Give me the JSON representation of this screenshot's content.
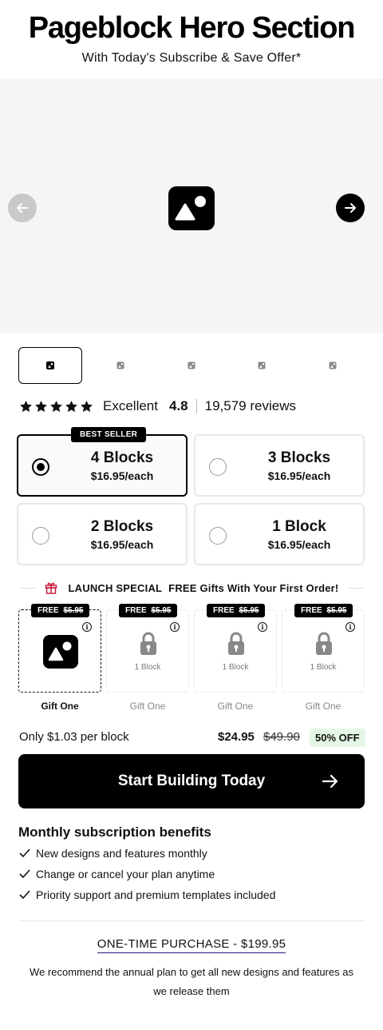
{
  "header": {
    "title": "Pageblock Hero Section",
    "subtitle": "With Today's Subscribe & Save Offer*"
  },
  "gallery": {
    "icon": "image-placeholder-icon",
    "prev_icon": "arrow-left-icon",
    "next_icon": "arrow-right-icon",
    "thumbnail_count": 5,
    "active_thumbnail": 1
  },
  "rating": {
    "stars": 5,
    "label": "Excellent",
    "score": "4.8",
    "reviews": "19,579 reviews"
  },
  "options": [
    {
      "name": "4 Blocks",
      "price": "$16.95/each",
      "selected": true,
      "badge": "BEST SELLER"
    },
    {
      "name": "3 Blocks",
      "price": "$16.95/each",
      "selected": false
    },
    {
      "name": "2 Blocks",
      "price": "$16.95/each",
      "selected": false
    },
    {
      "name": "1 Block",
      "price": "$16.95/each",
      "selected": false
    }
  ],
  "launch": {
    "icon": "gift-icon",
    "label": "LAUNCH SPECIAL",
    "text": "FREE Gifts With Your First Order!"
  },
  "gifts": [
    {
      "free": "FREE",
      "was": "$5.95",
      "locked": false,
      "caption": "Gift One"
    },
    {
      "free": "FREE",
      "was": "$5.95",
      "locked": true,
      "lock_label": "1 Block",
      "caption": "Gift One"
    },
    {
      "free": "FREE",
      "was": "$5.95",
      "locked": true,
      "lock_label": "1 Block",
      "caption": "Gift One"
    },
    {
      "free": "FREE",
      "was": "$5.95",
      "locked": true,
      "lock_label": "1 Block",
      "caption": "Gift One"
    }
  ],
  "pricing": {
    "per_block": "Only $1.03 per block",
    "current": "$24.95",
    "original": "$49.90",
    "discount": "50% OFF"
  },
  "cta": {
    "label": "Start Building Today"
  },
  "benefits": {
    "title": "Monthly subscription benefits",
    "items": [
      "New designs and features monthly",
      "Change or cancel your plan anytime",
      "Priority support and premium templates included"
    ]
  },
  "one_time": {
    "label": "ONE-TIME PURCHASE - $199.95",
    "note": "We recommend the annual plan to get all new designs and features as we release them"
  },
  "colors": {
    "accent": "#000000",
    "discount_bg": "#e4f7e6",
    "hero_bg": "#f5f5f5"
  }
}
